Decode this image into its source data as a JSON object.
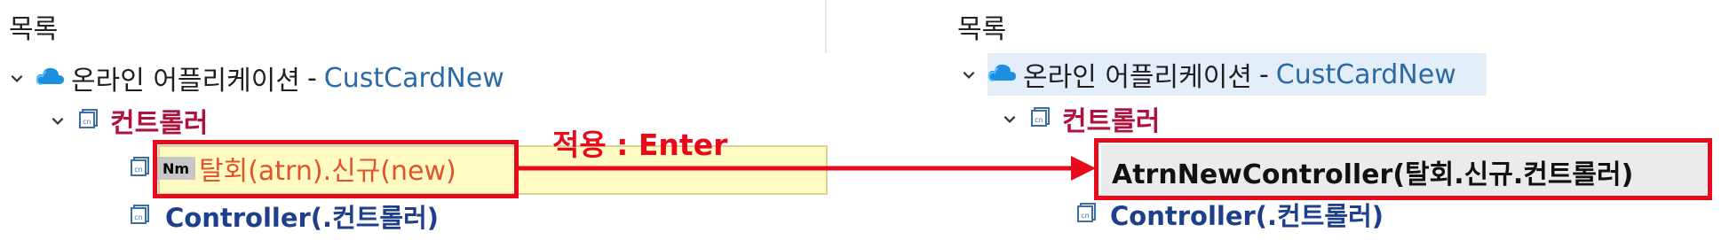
{
  "left": {
    "section_title": "목록",
    "app_label": "온라인 어플리케이션",
    "app_sep": "-",
    "app_name": "CustCardNew",
    "group_label": "컨트롤러",
    "edit_badge": "Nm",
    "edit_value": "탈회(atrn).신규(new)",
    "controller_label": "Controller(.컨트롤러)"
  },
  "right": {
    "section_title": "목록",
    "app_label": "온라인 어플리케이션",
    "app_sep": "-",
    "app_name": "CustCardNew",
    "group_label": "컨트롤러",
    "new_item_label": "AtrnNewController(탈회.신규.컨트롤러)",
    "controller_label": "Controller(.컨트롤러)"
  },
  "annotation": {
    "caption": "적용 : Enter"
  },
  "colors": {
    "annotation_red": "#e8091a",
    "app_name_blue": "#2c6aa6",
    "group_crimson": "#b0123e",
    "controller_navy": "#1e3f8a",
    "edit_bg": "#fffbc2",
    "selection_bg": "#e3eef9"
  },
  "icons": [
    "chevron-down-icon",
    "cloud-icon",
    "controller-icon",
    "selected-arrow-icon"
  ]
}
